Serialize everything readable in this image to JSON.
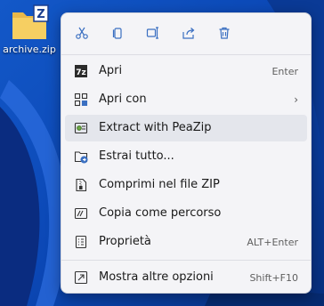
{
  "desktop": {
    "file_label": "archive.zip",
    "file_icon": "zip-folder-icon"
  },
  "toolbar": {
    "buttons": [
      {
        "name": "cut",
        "icon": "scissors-icon"
      },
      {
        "name": "copy",
        "icon": "copy-icon"
      },
      {
        "name": "rename",
        "icon": "rename-icon"
      },
      {
        "name": "share",
        "icon": "share-icon"
      },
      {
        "name": "delete",
        "icon": "trash-icon"
      }
    ]
  },
  "menu": {
    "items": [
      {
        "label": "Apri",
        "shortcut": "Enter",
        "icon": "open-icon"
      },
      {
        "label": "Apri con",
        "shortcut": "",
        "icon": "open-with-icon",
        "submenu": true
      },
      {
        "label": "Extract with PeaZip",
        "shortcut": "",
        "icon": "peazip-icon",
        "highlighted": true
      },
      {
        "label": "Estrai tutto...",
        "shortcut": "",
        "icon": "extract-all-icon"
      },
      {
        "label": "Comprimi nel file ZIP",
        "shortcut": "",
        "icon": "zip-file-icon"
      },
      {
        "label": "Copia come percorso",
        "shortcut": "",
        "icon": "copy-path-icon"
      },
      {
        "label": "Proprietà",
        "shortcut": "ALT+Enter",
        "icon": "properties-icon"
      },
      {
        "label": "Mostra altre opzioni",
        "shortcut": "Shift+F10",
        "icon": "more-options-icon"
      }
    ]
  },
  "colors": {
    "menu_bg": "#f4f4f7",
    "hover_bg": "#e4e6ec",
    "accent": "#3a6fc1"
  }
}
